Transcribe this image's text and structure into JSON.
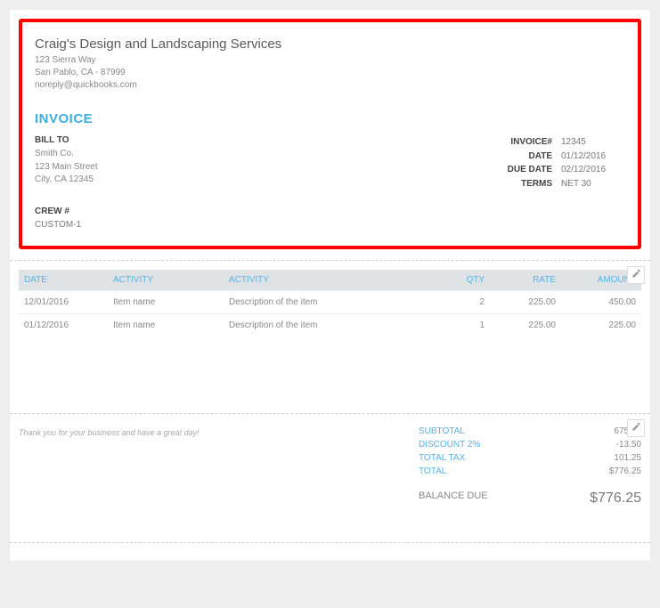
{
  "company": {
    "name": "Craig's Design and Landscaping Services",
    "addr1": "123 Sierra Way",
    "addr2": "San Pablo, CA - 87999",
    "email": "noreply@quickbooks.com"
  },
  "doc_title": "INVOICE",
  "bill_to_heading": "BILL TO",
  "bill_to": {
    "name": "Smith Co.",
    "addr1": "123 Main Street",
    "addr2": "City, CA 12345"
  },
  "meta": {
    "invoice_no_label": "INVOICE#",
    "invoice_no": "12345",
    "date_label": "DATE",
    "date": "01/12/2016",
    "due_label": "DUE DATE",
    "due": "02/12/2016",
    "terms_label": "TERMS",
    "terms": "NET 30"
  },
  "crew": {
    "label": "CREW #",
    "value": "CUSTOM-1"
  },
  "columns": {
    "date": "DATE",
    "activity1": "ACTIVITY",
    "activity2": "ACTIVITY",
    "qty": "QTY",
    "rate": "RATE",
    "amount": "AMOUNT"
  },
  "line_items": [
    {
      "date": "12/01/2016",
      "activity1": "Item name",
      "activity2": "Description of the item",
      "qty": "2",
      "rate": "225.00",
      "amount": "450.00"
    },
    {
      "date": "01/12/2016",
      "activity1": "Item name",
      "activity2": "Description of the item",
      "qty": "1",
      "rate": "225.00",
      "amount": "225.00"
    }
  ],
  "footer_message": "Thank you for your business and have a great day!",
  "totals": {
    "subtotal_label": "SUBTOTAL",
    "subtotal": "675.00",
    "discount_label": "DISCOUNT 2%",
    "discount": "-13.50",
    "tax_label": "TOTAL TAX",
    "tax": "101.25",
    "total_label": "TOTAL",
    "total": "$776.25",
    "balance_label": "BALANCE DUE",
    "balance": "$776.25"
  }
}
